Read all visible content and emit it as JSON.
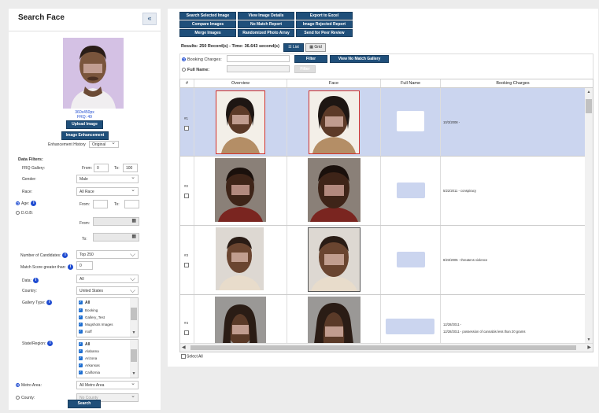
{
  "left_panel": {
    "title": "Search Face",
    "collapse_glyph": "«",
    "probe_size": "360x450px",
    "probe_frq": "FRQ: 49",
    "upload_label": "Upload Image",
    "enhance_label": "Image Enhancement",
    "enhancement_history_label": "Enhancement History",
    "enhancement_history_value": "Original",
    "filters_title": "Data Filters:",
    "frq_gallery_label": "FRQ Gallery:",
    "frq_from_label": "From:",
    "frq_from_value": "0",
    "frq_to_label": "To:",
    "frq_to_value": "100",
    "gender_label": "Gender:",
    "gender_value": "Male",
    "race_label": "Race:",
    "race_value": "All Race",
    "age_label": "Age:",
    "age_from_label": "From:",
    "age_to_label": "To:",
    "dob_label": "D.O.B:",
    "dob_from_label": "From:",
    "dob_to_label": "To:",
    "calendar_glyph": "▦",
    "candidates_label": "Number of Candidates:",
    "candidates_value": "Top 250",
    "match_label": "Match Score greater than:",
    "match_value": "0",
    "data_label": "Data:",
    "data_value": "All",
    "country_label": "Country:",
    "country_value": "United States",
    "gallery_type_label": "Gallery Type:",
    "gallery_items": [
      "All",
      "Booking",
      "Gallery_Test",
      "Mugshots Images",
      "rsoff"
    ],
    "state_label": "State/Region:",
    "state_items": [
      "All",
      "Alabama",
      "Arizona",
      "Arkansas",
      "California"
    ],
    "metro_label": "Metro Area:",
    "metro_value": "All Metro Area",
    "county_label": "County:",
    "county_value": "No County",
    "search_label": "Search"
  },
  "toolbar": {
    "row1": [
      "Search Selected Image",
      "View Image Details",
      "Export to Excel"
    ],
    "row2": [
      "Compare Images",
      "No Match Report",
      "Image Rejected Report"
    ],
    "row3": [
      "Merge Images",
      "Randomized Photo Array",
      "Send for Peer Review"
    ]
  },
  "results": {
    "summary": "Results: 250 Record(s) - Time: 36.643 second(s)",
    "list_label": "☰ List",
    "grid_label": "▦ Grid",
    "booking_label": "Booking Charges:",
    "fullname_label": "Full Name:",
    "filter_label": "Filter",
    "filter2_label": "Filter",
    "nomatch_label": "View No Match Gallery"
  },
  "table": {
    "headers": [
      "#",
      "Overview",
      "Face",
      "Full Name",
      "Booking Charges"
    ],
    "rows": [
      {
        "num": "#1",
        "charges": [
          "10/3/2008 -"
        ]
      },
      {
        "num": "#2",
        "charges": [
          "5/22/2011 - conspiracy"
        ]
      },
      {
        "num": "#3",
        "charges": [
          "8/23/2005 - threatens violence"
        ]
      },
      {
        "num": "#4",
        "charges": [
          "12/28/2011 -",
          "12/28/2011 - possession of cannabis less than 20 grams"
        ]
      }
    ],
    "select_all": "Select All"
  },
  "colors": {
    "accent": "#1f4f7a",
    "selected_row": "#cbd5ef",
    "selected_border": "#d0312d"
  }
}
